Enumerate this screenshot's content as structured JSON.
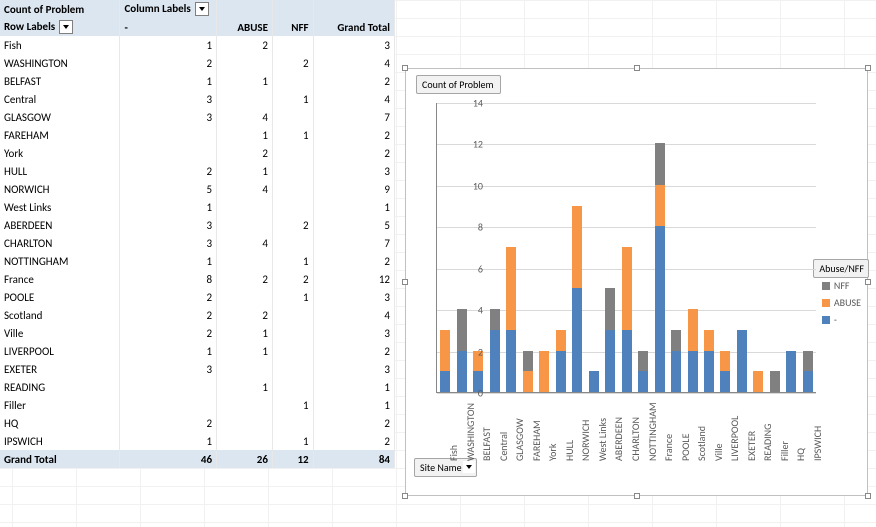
{
  "pivot": {
    "title": "Count of Problem",
    "column_header": "Column Labels",
    "row_header": "Row Labels",
    "columns": [
      "-",
      "ABUSE",
      "NFF",
      "Grand Total"
    ],
    "rows": [
      {
        "label": "Fish",
        "dash": 1,
        "abuse": 2,
        "nff": null,
        "total": 3
      },
      {
        "label": "WASHINGTON",
        "dash": 2,
        "abuse": null,
        "nff": 2,
        "total": 4
      },
      {
        "label": "BELFAST",
        "dash": 1,
        "abuse": 1,
        "nff": null,
        "total": 2
      },
      {
        "label": "Central",
        "dash": 3,
        "abuse": null,
        "nff": 1,
        "total": 4
      },
      {
        "label": "GLASGOW",
        "dash": 3,
        "abuse": 4,
        "nff": null,
        "total": 7
      },
      {
        "label": "FAREHAM",
        "dash": null,
        "abuse": 1,
        "nff": 1,
        "total": 2
      },
      {
        "label": "York",
        "dash": null,
        "abuse": 2,
        "nff": null,
        "total": 2
      },
      {
        "label": "HULL",
        "dash": 2,
        "abuse": 1,
        "nff": null,
        "total": 3
      },
      {
        "label": "NORWICH",
        "dash": 5,
        "abuse": 4,
        "nff": null,
        "total": 9
      },
      {
        "label": "West Links",
        "dash": 1,
        "abuse": null,
        "nff": null,
        "total": 1
      },
      {
        "label": "ABERDEEN",
        "dash": 3,
        "abuse": null,
        "nff": 2,
        "total": 5
      },
      {
        "label": "CHARLTON",
        "dash": 3,
        "abuse": 4,
        "nff": null,
        "total": 7
      },
      {
        "label": "NOTTINGHAM",
        "dash": 1,
        "abuse": null,
        "nff": 1,
        "total": 2
      },
      {
        "label": "France",
        "dash": 8,
        "abuse": 2,
        "nff": 2,
        "total": 12
      },
      {
        "label": "POOLE",
        "dash": 2,
        "abuse": null,
        "nff": 1,
        "total": 3
      },
      {
        "label": "Scotland",
        "dash": 2,
        "abuse": 2,
        "nff": null,
        "total": 4
      },
      {
        "label": "Ville",
        "dash": 2,
        "abuse": 1,
        "nff": null,
        "total": 3
      },
      {
        "label": "LIVERPOOL",
        "dash": 1,
        "abuse": 1,
        "nff": null,
        "total": 2
      },
      {
        "label": "EXETER",
        "dash": 3,
        "abuse": null,
        "nff": null,
        "total": 3
      },
      {
        "label": "READING",
        "dash": null,
        "abuse": 1,
        "nff": null,
        "total": 1
      },
      {
        "label": "Filler",
        "dash": null,
        "abuse": null,
        "nff": 1,
        "total": 1
      },
      {
        "label": "HQ",
        "dash": 2,
        "abuse": null,
        "nff": null,
        "total": 2
      },
      {
        "label": "IPSWICH",
        "dash": 1,
        "abuse": null,
        "nff": 1,
        "total": 2
      }
    ],
    "grand_total": {
      "label": "Grand Total",
      "dash": 46,
      "abuse": 26,
      "nff": 12,
      "total": 84
    }
  },
  "chart": {
    "field_count": "Count of Problem",
    "field_axis": "Site Name",
    "legend_title": "Abuse/NFF",
    "legend_items": [
      "NFF",
      "ABUSE",
      "-"
    ]
  },
  "chart_data": {
    "type": "bar",
    "stacked": true,
    "categories": [
      "Fish",
      "WASHINGTON",
      "BELFAST",
      "Central",
      "GLASGOW",
      "FAREHAM",
      "York",
      "HULL",
      "NORWICH",
      "West Links",
      "ABERDEEN",
      "CHARLTON",
      "NOTTINGHAM",
      "France",
      "POOLE",
      "Scotland",
      "Ville",
      "LIVERPOOL",
      "EXETER",
      "READING",
      "Filler",
      "HQ",
      "IPSWICH"
    ],
    "series": [
      {
        "name": "-",
        "color": "#4f81bd",
        "values": [
          1,
          2,
          1,
          3,
          3,
          0,
          0,
          2,
          5,
          1,
          3,
          3,
          1,
          8,
          2,
          2,
          2,
          1,
          3,
          0,
          0,
          2,
          1
        ]
      },
      {
        "name": "ABUSE",
        "color": "#f79646",
        "values": [
          2,
          0,
          1,
          0,
          4,
          1,
          2,
          1,
          4,
          0,
          0,
          4,
          0,
          2,
          0,
          2,
          1,
          1,
          0,
          1,
          0,
          0,
          0
        ]
      },
      {
        "name": "NFF",
        "color": "#808080",
        "values": [
          0,
          2,
          0,
          1,
          0,
          1,
          0,
          0,
          0,
          0,
          2,
          0,
          1,
          2,
          1,
          0,
          0,
          0,
          0,
          0,
          1,
          0,
          1
        ]
      }
    ],
    "title": "",
    "xlabel": "",
    "ylabel": "",
    "ylim": [
      0,
      14
    ],
    "yticks": [
      0,
      2,
      4,
      6,
      8,
      10,
      12,
      14
    ]
  }
}
